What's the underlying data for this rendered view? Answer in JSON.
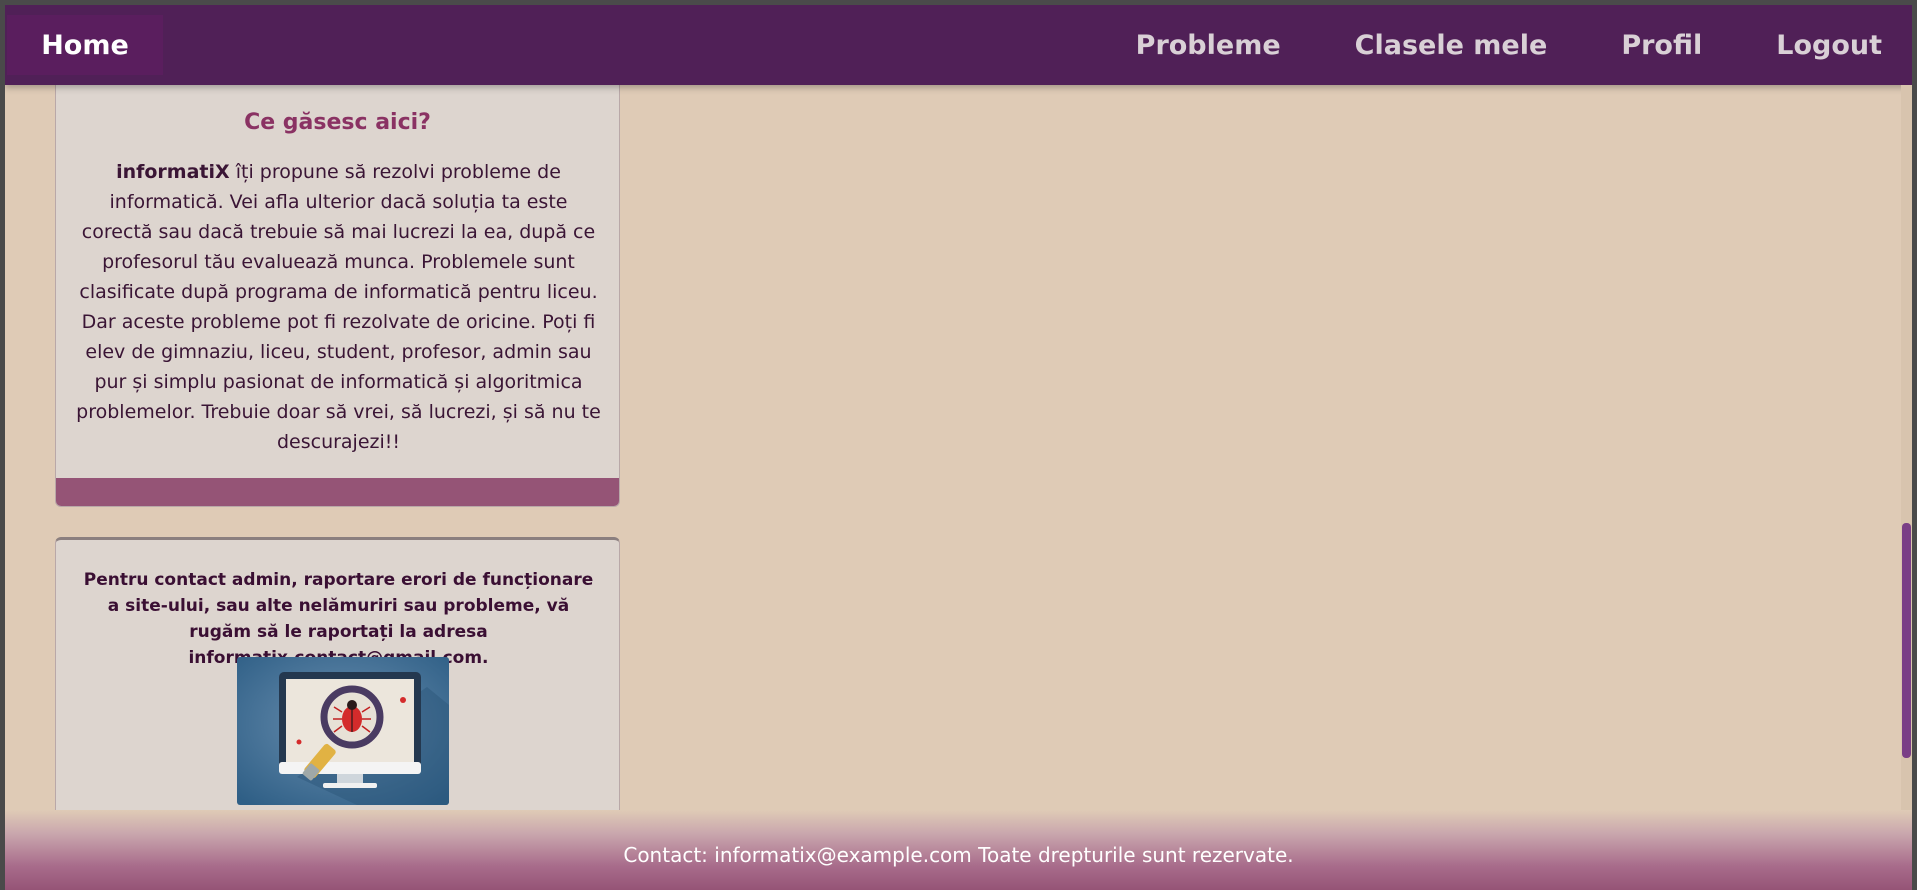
{
  "nav": {
    "home": "Home",
    "links": [
      "Probleme",
      "Clasele mele",
      "Profil",
      "Logout"
    ]
  },
  "info_card": {
    "title": "Ce găsesc aici?",
    "brand": "informatiX",
    "text": " îți propune să rezolvi probleme de informatică. Vei afla ulterior dacă soluția ta este corectă sau dacă trebuie să mai lucrezi la ea, după ce profesorul tău evaluează munca. Problemele sunt clasificate după programa de informatică pentru liceu. Dar aceste probleme pot fi rezolvate de oricine. Poți fi elev de gimnaziu, liceu, student, profesor, admin sau pur și simplu pasionat de informatică și algoritmica problemelor. Trebuie doar să vrei, să lucrezi, și să nu te descurajezi!!"
  },
  "contact_card": {
    "text": "Pentru contact admin, raportare erori de funcționare a site-ului, sau alte nelămuriri sau probleme, vă rugăm să le raportați la adresa informatix.contact@gmail.com.",
    "image_icon": "bug-report-icon"
  },
  "footer": {
    "text": "Contact: informatix@example.com Toate drepturile sunt rezervate."
  },
  "colors": {
    "navbar": "#502057",
    "background": "#dfcbb6",
    "accent": "#955476",
    "title": "#8a3263"
  }
}
